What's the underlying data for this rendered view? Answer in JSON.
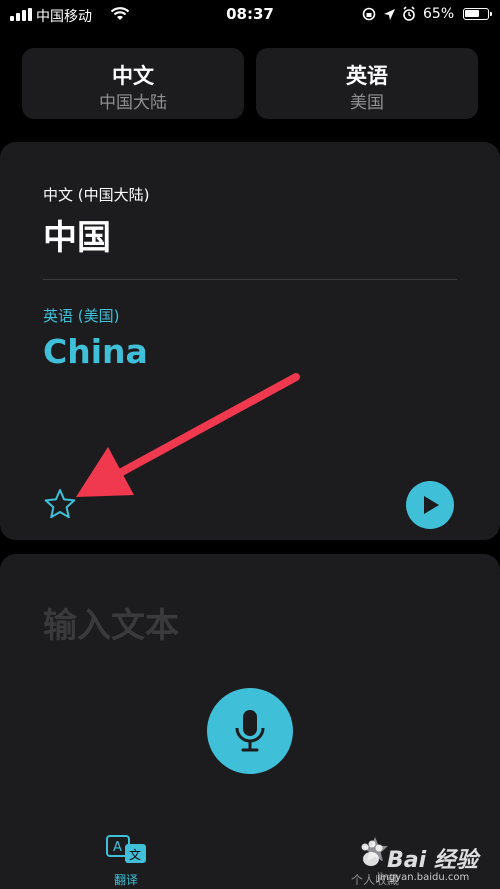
{
  "status_bar": {
    "carrier": "中国移动",
    "time": "08:37",
    "battery_percent": "65%",
    "battery_level": 0.65
  },
  "language_selector": {
    "source": {
      "name": "中文",
      "region": "中国大陆"
    },
    "target": {
      "name": "英语",
      "region": "美国"
    }
  },
  "translation": {
    "source_label": "中文 (中国大陆)",
    "source_text": "中国",
    "target_label": "英语 (美国)",
    "target_text": "China"
  },
  "input": {
    "placeholder": "输入文本"
  },
  "tab_bar": {
    "translate_label": "翻译",
    "favorites_label": "个人收藏"
  },
  "watermark": {
    "brand": "Bai 经验",
    "url": "jingyan.baidu.com"
  },
  "colors": {
    "accent": "#3fc0d8",
    "annotation_arrow": "#f0384e",
    "card_bg": "#1c1c1e",
    "background": "#000000"
  },
  "icons": {
    "star": "star-outline-icon",
    "play": "play-icon",
    "mic": "microphone-icon",
    "translate_tab": "translate-icon"
  }
}
